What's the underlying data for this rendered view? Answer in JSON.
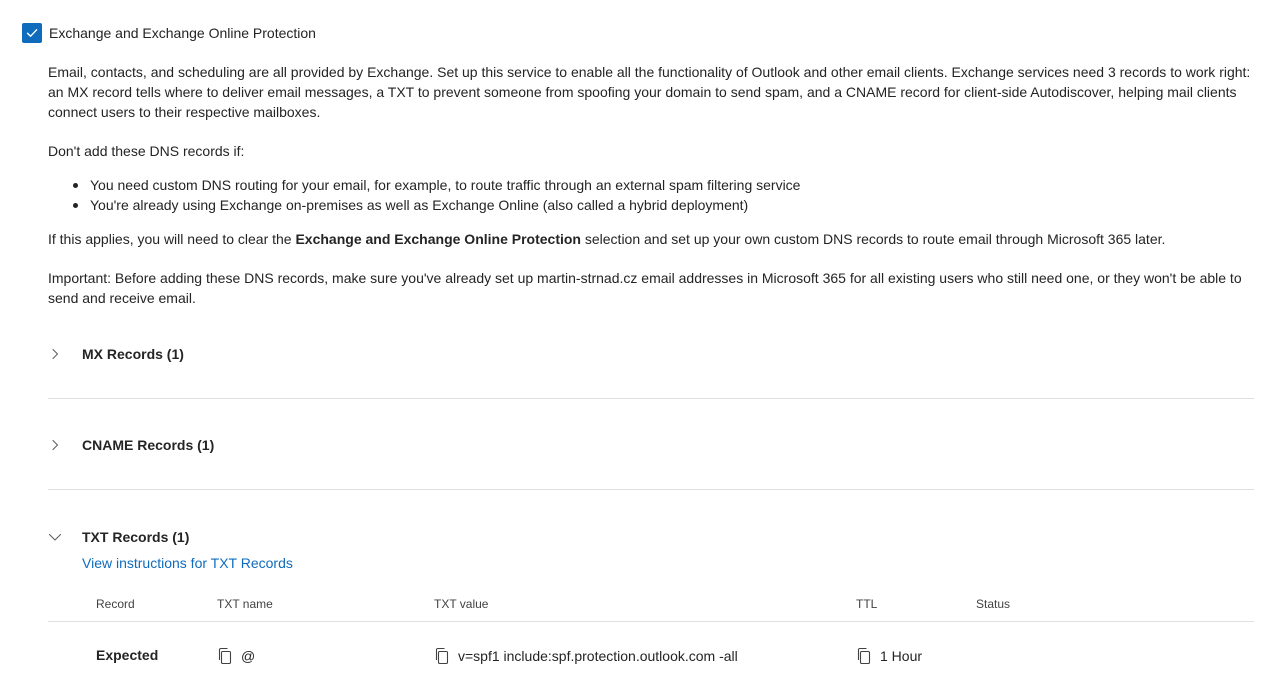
{
  "service": {
    "checked": true,
    "label": "Exchange and Exchange Online Protection"
  },
  "description": {
    "intro": "Email, contacts, and scheduling are all provided by Exchange. Set up this service to enable all the functionality of Outlook and other email clients. Exchange services need 3 records to work right: an MX record tells where to deliver email messages, a TXT to prevent someone from spoofing your domain to send spam, and a CNAME record for client-side Autodiscover, helping mail clients connect users to their respective mailboxes.",
    "dont_add": "Don't add these DNS records if:",
    "bullets": [
      "You need custom DNS routing for your email, for example, to route traffic through an external spam filtering service",
      "You're already using Exchange on-premises as well as Exchange Online (also called a hybrid deployment)"
    ],
    "applies_prefix": "If this applies, you will need to clear the ",
    "applies_bold": "Exchange and Exchange Online Protection",
    "applies_suffix": " selection and set up your own custom DNS records to route email through Microsoft 365 later.",
    "important": "Important: Before adding these DNS records, make sure you've already set up martin-strnad.cz email addresses in Microsoft 365 for all existing users who still need one, or they won't be able to send and receive email."
  },
  "sections": {
    "mx": {
      "title": "MX Records (1)",
      "expanded": false
    },
    "cname": {
      "title": "CNAME Records (1)",
      "expanded": false
    },
    "txt": {
      "title": "TXT Records (1)",
      "expanded": true,
      "instructions_link": "View instructions for TXT Records",
      "columns": [
        "Record",
        "TXT name",
        "TXT value",
        "TTL",
        "Status"
      ],
      "rows": [
        {
          "record": "Expected",
          "txt_name": "@",
          "txt_value": "v=spf1 include:spf.protection.outlook.com -all",
          "ttl": "1 Hour",
          "status": ""
        }
      ]
    }
  },
  "colors": {
    "accent": "#0f6cbd",
    "text": "#242424",
    "divider": "#e0e0e0"
  },
  "icons": {
    "checkbox": "checkmark-icon",
    "collapsed": "chevron-right-icon",
    "expanded": "chevron-down-icon",
    "copy": "copy-icon"
  }
}
